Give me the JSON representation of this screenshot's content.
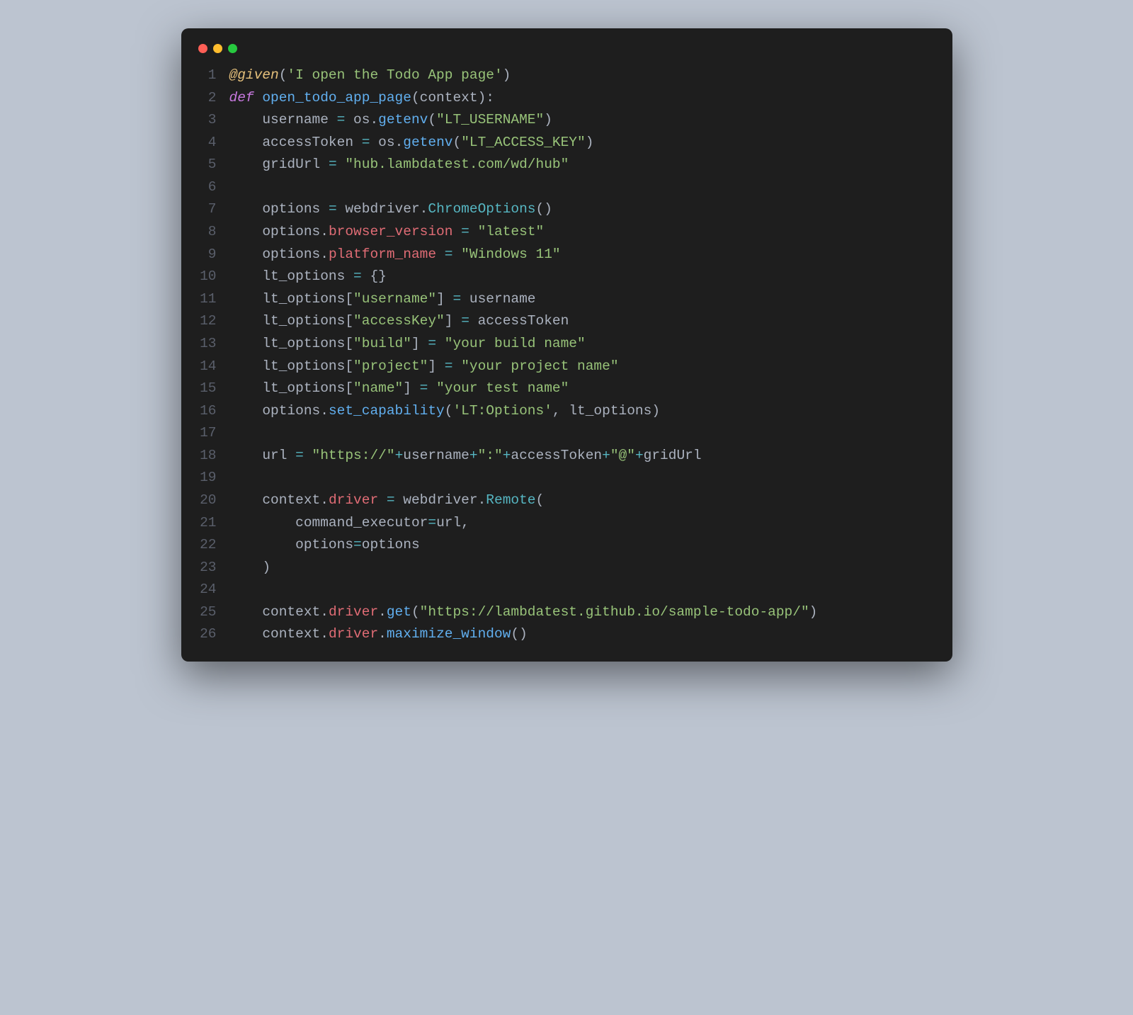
{
  "window": {
    "traffic_lights": [
      "red",
      "yellow",
      "green"
    ]
  },
  "code": {
    "total_lines": 26,
    "lines": [
      {
        "n": "1",
        "html": "<span class='tok-dec'>@given</span><span class='tok-punct'>(</span><span class='tok-str'>'I open the Todo App page'</span><span class='tok-punct'>)</span>"
      },
      {
        "n": "2",
        "html": "<span class='tok-kw'>def</span> <span class='tok-fn'>open_todo_app_page</span><span class='tok-punct'>(</span><span class='tok-param'>context</span><span class='tok-punct'>):</span>"
      },
      {
        "n": "3",
        "html": "    <span class='tok-plain'>username</span> <span class='tok-op'>=</span> <span class='tok-plain'>os</span><span class='tok-punct'>.</span><span class='tok-fn'>getenv</span><span class='tok-punct'>(</span><span class='tok-str'>\"LT_USERNAME\"</span><span class='tok-punct'>)</span>"
      },
      {
        "n": "4",
        "html": "    <span class='tok-plain'>accessToken</span> <span class='tok-op'>=</span> <span class='tok-plain'>os</span><span class='tok-punct'>.</span><span class='tok-fn'>getenv</span><span class='tok-punct'>(</span><span class='tok-str'>\"LT_ACCESS_KEY\"</span><span class='tok-punct'>)</span>"
      },
      {
        "n": "5",
        "html": "    <span class='tok-plain'>gridUrl</span> <span class='tok-op'>=</span> <span class='tok-str'>\"hub.lambdatest.com/wd/hub\"</span>"
      },
      {
        "n": "6",
        "html": ""
      },
      {
        "n": "7",
        "html": "    <span class='tok-plain'>options</span> <span class='tok-op'>=</span> <span class='tok-plain'>webdriver</span><span class='tok-punct'>.</span><span class='tok-cls'>ChromeOptions</span><span class='tok-punct'>()</span>"
      },
      {
        "n": "8",
        "html": "    <span class='tok-plain'>options</span><span class='tok-punct'>.</span><span class='tok-id'>browser_version</span> <span class='tok-op'>=</span> <span class='tok-str'>\"latest\"</span>"
      },
      {
        "n": "9",
        "html": "    <span class='tok-plain'>options</span><span class='tok-punct'>.</span><span class='tok-id'>platform_name</span> <span class='tok-op'>=</span> <span class='tok-str'>\"Windows 11\"</span>"
      },
      {
        "n": "10",
        "html": "    <span class='tok-plain'>lt_options</span> <span class='tok-op'>=</span> <span class='tok-punct'>{}</span>"
      },
      {
        "n": "11",
        "html": "    <span class='tok-plain'>lt_options</span><span class='tok-punct'>[</span><span class='tok-str'>\"username\"</span><span class='tok-punct'>]</span> <span class='tok-op'>=</span> <span class='tok-plain'>username</span>"
      },
      {
        "n": "12",
        "html": "    <span class='tok-plain'>lt_options</span><span class='tok-punct'>[</span><span class='tok-str'>\"accessKey\"</span><span class='tok-punct'>]</span> <span class='tok-op'>=</span> <span class='tok-plain'>accessToken</span>"
      },
      {
        "n": "13",
        "html": "    <span class='tok-plain'>lt_options</span><span class='tok-punct'>[</span><span class='tok-str'>\"build\"</span><span class='tok-punct'>]</span> <span class='tok-op'>=</span> <span class='tok-str'>\"your build name\"</span>"
      },
      {
        "n": "14",
        "html": "    <span class='tok-plain'>lt_options</span><span class='tok-punct'>[</span><span class='tok-str'>\"project\"</span><span class='tok-punct'>]</span> <span class='tok-op'>=</span> <span class='tok-str'>\"your project name\"</span>"
      },
      {
        "n": "15",
        "html": "    <span class='tok-plain'>lt_options</span><span class='tok-punct'>[</span><span class='tok-str'>\"name\"</span><span class='tok-punct'>]</span> <span class='tok-op'>=</span> <span class='tok-str'>\"your test name\"</span>"
      },
      {
        "n": "16",
        "html": "    <span class='tok-plain'>options</span><span class='tok-punct'>.</span><span class='tok-fn'>set_capability</span><span class='tok-punct'>(</span><span class='tok-str'>'LT:Options'</span><span class='tok-punct'>,</span> <span class='tok-plain'>lt_options</span><span class='tok-punct'>)</span>"
      },
      {
        "n": "17",
        "html": ""
      },
      {
        "n": "18",
        "html": "    <span class='tok-plain'>url</span> <span class='tok-op'>=</span> <span class='tok-str'>\"https://\"</span><span class='tok-op'>+</span><span class='tok-plain'>username</span><span class='tok-op'>+</span><span class='tok-str'>\":\"</span><span class='tok-op'>+</span><span class='tok-plain'>accessToken</span><span class='tok-op'>+</span><span class='tok-str'>\"@\"</span><span class='tok-op'>+</span><span class='tok-plain'>gridUrl</span>"
      },
      {
        "n": "19",
        "html": ""
      },
      {
        "n": "20",
        "html": "    <span class='tok-plain'>context</span><span class='tok-punct'>.</span><span class='tok-id'>driver</span> <span class='tok-op'>=</span> <span class='tok-plain'>webdriver</span><span class='tok-punct'>.</span><span class='tok-cls'>Remote</span><span class='tok-punct'>(</span>"
      },
      {
        "n": "21",
        "html": "        <span class='tok-param'>command_executor</span><span class='tok-op'>=</span><span class='tok-plain'>url</span><span class='tok-punct'>,</span>"
      },
      {
        "n": "22",
        "html": "        <span class='tok-param'>options</span><span class='tok-op'>=</span><span class='tok-plain'>options</span>"
      },
      {
        "n": "23",
        "html": "    <span class='tok-punct'>)</span>"
      },
      {
        "n": "24",
        "html": ""
      },
      {
        "n": "25",
        "html": "    <span class='tok-plain'>context</span><span class='tok-punct'>.</span><span class='tok-id'>driver</span><span class='tok-punct'>.</span><span class='tok-fn'>get</span><span class='tok-punct'>(</span><span class='tok-str'>\"https://lambdatest.github.io/sample-todo-app/\"</span><span class='tok-punct'>)</span>"
      },
      {
        "n": "26",
        "html": "    <span class='tok-plain'>context</span><span class='tok-punct'>.</span><span class='tok-id'>driver</span><span class='tok-punct'>.</span><span class='tok-fn'>maximize_window</span><span class='tok-punct'>()</span>"
      }
    ]
  }
}
